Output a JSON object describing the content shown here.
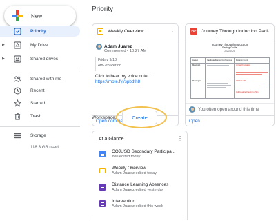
{
  "new_button": {
    "label": "New"
  },
  "sidebar": {
    "items": [
      {
        "label": "Priority",
        "icon": "priority-check-icon"
      },
      {
        "label": "My Drive",
        "icon": "my-drive-icon"
      },
      {
        "label": "Shared drives",
        "icon": "shared-drives-icon"
      },
      {
        "label": "Shared with me",
        "icon": "people-icon"
      },
      {
        "label": "Recent",
        "icon": "clock-icon"
      },
      {
        "label": "Starred",
        "icon": "star-icon"
      },
      {
        "label": "Trash",
        "icon": "trash-icon"
      },
      {
        "label": "Storage",
        "icon": "storage-icon"
      }
    ],
    "storage_used": "118.3 GB used"
  },
  "main": {
    "title": "Priority",
    "cards": [
      {
        "title": "Weekly Overview",
        "icon": "slides-icon",
        "comment": {
          "author": "Adam Juarez",
          "time": "Commented • 10:27 AM",
          "quote_line1": "Friday 9/18",
          "quote_line2": "4th-7th Period",
          "text": "Click to hear my voice note...",
          "link": "https://mote.fyi/spbdth8"
        },
        "footer": "Open comment"
      },
      {
        "title": "Journey Through Induction Paci...",
        "icon": "pdf-icon",
        "preview": {
          "heading1": "Journey Through Induction",
          "heading2": "Pacing Guide",
          "heading3": "2020-2021",
          "col_headers": [
            "August",
            "Candidate/Mentor Conferences",
            "Program Event"
          ],
          "row_labels": [
            "Meeting 1",
            "Meeting 2"
          ],
          "events": [
            "Virtual Orientation",
            "ILP Kick-Off",
            "Individualized Learning Plan"
          ]
        },
        "suggestion": "You often open around this time",
        "footer": "Open"
      }
    ],
    "workspaces_label": "Workspaces",
    "create_label": "Create",
    "glance": {
      "title": "At a Glance",
      "items": [
        {
          "title": "COJUSD Secondary Participa...",
          "subtitle": "You edited today",
          "icon": "docs-icon"
        },
        {
          "title": "Weekly Overview",
          "subtitle": "Adam Juarez edited today",
          "icon": "slides-icon"
        },
        {
          "title": "Distance Learning Absences",
          "subtitle": "Adam Juarez edited yesterday",
          "icon": "forms-icon"
        },
        {
          "title": "Intervention",
          "subtitle": "Adam Juarez edited this week",
          "icon": "forms-icon"
        }
      ]
    }
  },
  "colors": {
    "accent": "#1a73e8",
    "active_bg": "#e8f0fe",
    "highlight": "#f2c14e"
  }
}
